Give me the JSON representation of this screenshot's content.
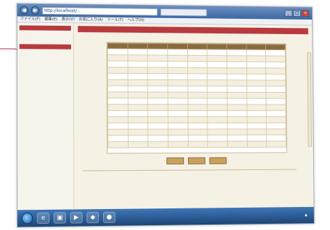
{
  "browser": {
    "address": "http://localhost/...",
    "tab_label": "",
    "menu": [
      "ファイル(F)",
      "編集(E)",
      "表示(V)",
      "お気に入り(A)",
      "ツール(T)",
      "ヘルプ(H)"
    ]
  },
  "sidebar": {
    "header1": "",
    "header2": "",
    "links": [
      "",
      "",
      "",
      "",
      "",
      "",
      "",
      "",
      "",
      "",
      "",
      "",
      "",
      "",
      ""
    ]
  },
  "main": {
    "title": "",
    "subtitle": "",
    "columns": [
      "",
      "",
      "",
      "",
      "",
      "",
      "",
      "",
      ""
    ],
    "rows": [
      [
        "",
        "",
        "",
        "",
        "",
        "",
        "",
        "",
        ""
      ],
      [
        "",
        "",
        "",
        "",
        "",
        "",
        "",
        "",
        ""
      ],
      [
        "",
        "",
        "",
        "",
        "",
        "",
        "",
        "",
        ""
      ],
      [
        "",
        "",
        "",
        "",
        "",
        "",
        "",
        "",
        ""
      ],
      [
        "",
        "",
        "",
        "",
        "",
        "",
        "",
        "",
        ""
      ],
      [
        "",
        "",
        "",
        "",
        "",
        "",
        "",
        "",
        ""
      ],
      [
        "",
        "",
        "",
        "",
        "",
        "",
        "",
        "",
        ""
      ],
      [
        "",
        "",
        "",
        "",
        "",
        "",
        "",
        "",
        ""
      ],
      [
        "",
        "",
        "",
        "",
        "",
        "",
        "",
        "",
        ""
      ],
      [
        "",
        "",
        "",
        "",
        "",
        "",
        "",
        "",
        ""
      ],
      [
        "",
        "",
        "",
        "",
        "",
        "",
        "",
        "",
        ""
      ],
      [
        "",
        "",
        "",
        "",
        "",
        "",
        "",
        "",
        ""
      ],
      [
        "",
        "",
        "",
        "",
        "",
        "",
        "",
        "",
        ""
      ],
      [
        "",
        "",
        "",
        "",
        "",
        "",
        "",
        "",
        ""
      ],
      [
        "",
        "",
        "",
        "",
        "",
        "",
        "",
        "",
        ""
      ],
      [
        "",
        "",
        "",
        "",
        "",
        "",
        "",
        "",
        ""
      ]
    ],
    "buttons": [
      "",
      "",
      ""
    ],
    "notice_lines": [
      "",
      "",
      "",
      ""
    ]
  },
  "taskbar": {
    "tray_time": "",
    "tray_date": ""
  },
  "colors": {
    "accent": "#b73a3e",
    "header": "#8a6b3f",
    "link": "#2c4f9f"
  }
}
